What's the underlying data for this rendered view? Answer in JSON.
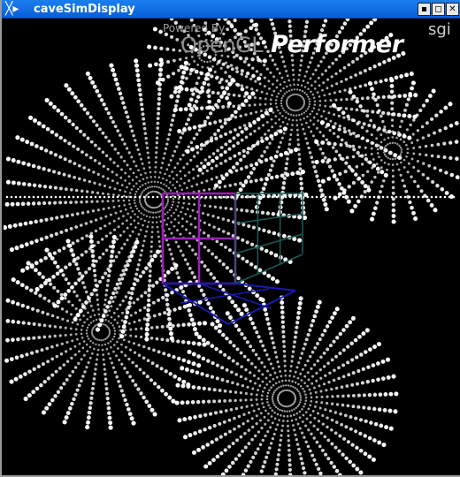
{
  "window": {
    "title": "caveSimDisplay",
    "menu_glyph": "╳▸",
    "controls": {
      "minimize": "▪",
      "maximize": "◻",
      "close": "✕"
    }
  },
  "branding": {
    "powered_by": "Powered By",
    "opengl": "OpenGL",
    "performer": "Performer",
    "sgi": "sgi"
  },
  "scene": {
    "description_colors": {
      "background": "#000000",
      "particles": "#ffffff",
      "wall_front": "#9b1fb8",
      "wall_right": "#1e5a55",
      "floor": "#1a1ab0"
    }
  }
}
